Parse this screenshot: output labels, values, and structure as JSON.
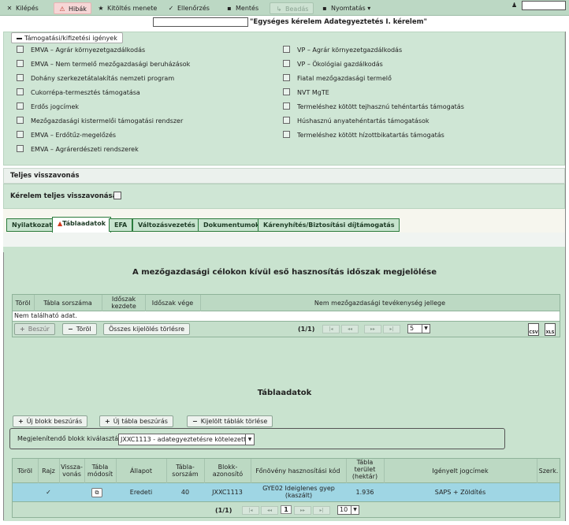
{
  "toolbar": {
    "items": [
      {
        "label": "Kilépés",
        "icon": "✕"
      },
      {
        "label": "Hibák",
        "icon": "⚠"
      },
      {
        "label": "Kitöltés menete",
        "icon": "★"
      },
      {
        "label": "Ellenőrzés",
        "icon": "✓"
      },
      {
        "label": "Mentés",
        "icon": "▪"
      },
      {
        "label": "Beadás",
        "icon": "↳"
      },
      {
        "label": "Nyomtatás",
        "icon": "▪",
        "caret": "▾"
      }
    ],
    "user_icon": "person-icon",
    "user_symbol": "♟"
  },
  "page_title": "\"Egységes kérelem Adategyeztetés I. kérelem\"",
  "claims": {
    "tab_label": "Támogatási/kifizetési igények",
    "left": [
      "EMVA – Agrár környezetgazdálkodás",
      "EMVA – Nem termelő mezőgazdasági beruházások",
      "Dohány szerkezetátalakítás nemzeti program",
      "Cukorrépa-termesztés támogatása",
      "Erdős jogcímek",
      "Mezőgazdasági kistermelői támogatási rendszer",
      "EMVA – Erdőtűz-megelőzés",
      "EMVA – Agrárerdészeti rendszerek"
    ],
    "right": [
      "VP – Agrár környezetgazdálkodás",
      "VP – Ökológiai gazdálkodás",
      "Fiatal mezőgazdasági termelő",
      "NVT MgTE",
      "Termeléshez kötött tejhasznú tehéntartás támogatás",
      "Húshasznú anyatehéntartás támogatások",
      "Termeléshez kötött hízottbikatartás támogatás"
    ]
  },
  "withdrawal": {
    "header": "Teljes visszavonás",
    "label": "Kérelem teljes visszavonása"
  },
  "tabs": [
    {
      "label": "Nyilatkozat",
      "active": false
    },
    {
      "label": "Táblaadatok",
      "active": true,
      "warn": "▲"
    },
    {
      "label": "EFA",
      "active": false
    },
    {
      "label": "Változásvezetés",
      "active": false
    },
    {
      "label": "Dokumentumok",
      "active": false
    },
    {
      "label": "Kárenyhítés/Biztosítási díjtámogatás",
      "active": false
    }
  ],
  "section1": {
    "title": "A mezőgazdasági célokon kívül eső hasznosítás időszak megjelölése",
    "columns": [
      "Töröl",
      "Tábla sorszáma",
      "Időszak kezdete",
      "Időszak vége",
      "Nem mezőgazdasági tevékenység jellege"
    ],
    "empty_text": "Nem található adat.",
    "btn_insert": "Beszúr",
    "btn_delete": "Töröl",
    "btn_clear": "Összes kijelölés törlésre",
    "page_info": "(1/1)",
    "page_size": "5",
    "export_csv": "CSV",
    "export_xls": "XLS"
  },
  "section2": {
    "title": "Táblaadatok",
    "btn_new_block": "Új blokk beszúrás",
    "btn_new_table": "Új tábla beszúrás",
    "btn_delete_selected": "Kijelölt táblák törlése",
    "block_label": "Megjelenítendő blokk kiválasztása:",
    "block_value": "JXXC1113 - adategyeztetésre kötelezett",
    "columns": [
      "Töröl",
      "Rajz",
      "Vissza-vonás",
      "Tábla módosít",
      "Állapot",
      "Tábla-sorszám",
      "Blokk-azonosító",
      "Főnövény hasznosítási kód",
      "Tábla terület (hektár)",
      "Igényelt jogcímek",
      "Szerk."
    ],
    "row": {
      "rajz": "✓",
      "allapot": "Eredeti",
      "sorszam": "40",
      "blokk": "JXXC1113",
      "fonoveny": "GYE02 Ideiglenes gyep (kaszált)",
      "terulet": "1.936",
      "jogcimek": "SAPS + Zöldítés"
    },
    "page_info": "(1/1)",
    "current_page": "1",
    "page_size": "10"
  },
  "pager_icons": [
    "|◂",
    "◂◂",
    "▸▸",
    "▸|"
  ]
}
